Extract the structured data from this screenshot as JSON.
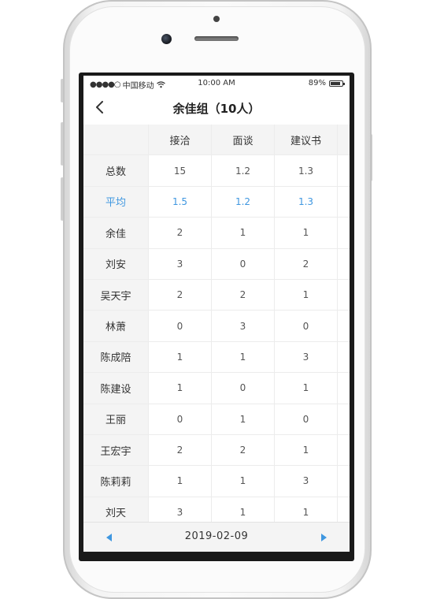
{
  "status_bar": {
    "signal": "●●●●○",
    "carrier": "中国移动",
    "time": "10:00 AM",
    "battery": "89%"
  },
  "nav": {
    "title": "余佳组（10人）"
  },
  "table": {
    "columns": [
      "接洽",
      "面谈",
      "建议书"
    ],
    "rows": [
      {
        "name": "总数",
        "values": [
          "15",
          "1.2",
          "1.3"
        ]
      },
      {
        "name": "平均",
        "values": [
          "1.5",
          "1.2",
          "1.3"
        ]
      },
      {
        "name": "余佳",
        "values": [
          "2",
          "1",
          "1"
        ]
      },
      {
        "name": "刘安",
        "values": [
          "3",
          "0",
          "2"
        ]
      },
      {
        "name": "吴天宇",
        "values": [
          "2",
          "2",
          "1"
        ]
      },
      {
        "name": "林萧",
        "values": [
          "0",
          "3",
          "0"
        ]
      },
      {
        "name": "陈成陪",
        "values": [
          "1",
          "1",
          "3"
        ]
      },
      {
        "name": "陈建设",
        "values": [
          "1",
          "0",
          "1"
        ]
      },
      {
        "name": "王丽",
        "values": [
          "0",
          "1",
          "0"
        ]
      },
      {
        "name": "王宏宇",
        "values": [
          "2",
          "2",
          "1"
        ]
      },
      {
        "name": "陈莉莉",
        "values": [
          "1",
          "1",
          "3"
        ]
      },
      {
        "name": "刘天",
        "values": [
          "3",
          "1",
          "1"
        ]
      }
    ]
  },
  "date_bar": {
    "date": "2019-02-09"
  },
  "colors": {
    "accent": "#3f97e0",
    "header_bg": "#f4f4f4",
    "border": "#ececec"
  }
}
